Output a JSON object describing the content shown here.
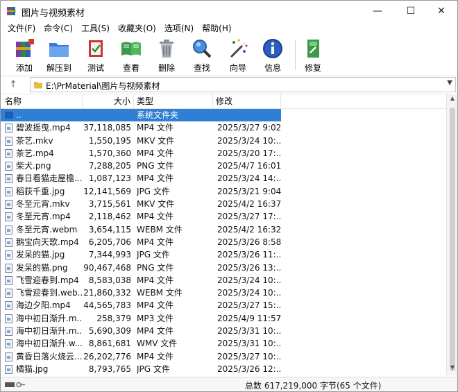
{
  "window": {
    "title": "图片与视频素材",
    "minimize_glyph": "—",
    "maximize_glyph": "☐",
    "close_glyph": "✕"
  },
  "menu": [
    "文件(F)",
    "命令(C)",
    "工具(S)",
    "收藏夹(O)",
    "选项(N)",
    "帮助(H)"
  ],
  "toolbar": [
    {
      "label": "添加",
      "icon": "add-archive-icon"
    },
    {
      "label": "解压到",
      "icon": "extract-folder-icon"
    },
    {
      "label": "测试",
      "icon": "test-icon"
    },
    {
      "label": "查看",
      "icon": "view-book-icon"
    },
    {
      "label": "删除",
      "icon": "trash-icon"
    },
    {
      "label": "查找",
      "icon": "find-magnifier-icon"
    },
    {
      "label": "向导",
      "icon": "wizard-wand-icon"
    },
    {
      "label": "信息",
      "icon": "info-icon"
    },
    {
      "label": "修复",
      "icon": "repair-icon"
    }
  ],
  "address": {
    "path": "E:\\PrMaterial\\图片与视频素材"
  },
  "columns": {
    "name": "名称",
    "size": "大小",
    "type": "类型",
    "modified": "修改"
  },
  "rows": [
    {
      "name": "..",
      "size": "",
      "type": "系统文件夹",
      "modified": "",
      "selected": true
    },
    {
      "name": "碧波摇曳.mp4",
      "size": "37,118,085",
      "type": "MP4 文件",
      "modified": "2025/3/27 9:02"
    },
    {
      "name": "茶艺.mkv",
      "size": "1,550,195",
      "type": "MKV 文件",
      "modified": "2025/3/24 10:..."
    },
    {
      "name": "茶艺.mp4",
      "size": "1,570,360",
      "type": "MP4 文件",
      "modified": "2025/3/20 17:..."
    },
    {
      "name": "柴犬.png",
      "size": "7,288,205",
      "type": "PNG 文件",
      "modified": "2025/4/7 16:01"
    },
    {
      "name": "春日看猫走屋檐...",
      "size": "1,087,123",
      "type": "MP4 文件",
      "modified": "2025/3/24 14:..."
    },
    {
      "name": "稻荻千重.jpg",
      "size": "12,141,569",
      "type": "JPG 文件",
      "modified": "2025/3/21 9:04"
    },
    {
      "name": "冬至元宵.mkv",
      "size": "3,715,561",
      "type": "MKV 文件",
      "modified": "2025/4/2 16:37"
    },
    {
      "name": "冬至元宵.mp4",
      "size": "2,118,462",
      "type": "MP4 文件",
      "modified": "2025/3/27 17:..."
    },
    {
      "name": "冬至元宵.webm",
      "size": "3,654,115",
      "type": "WEBM 文件",
      "modified": "2025/4/2 16:32"
    },
    {
      "name": "鹅宝向天歌.mp4",
      "size": "6,205,706",
      "type": "MP4 文件",
      "modified": "2025/3/26 8:58"
    },
    {
      "name": "发呆的猫.jpg",
      "size": "7,344,993",
      "type": "JPG 文件",
      "modified": "2025/3/26 11:..."
    },
    {
      "name": "发呆的猫.png",
      "size": "90,467,468",
      "type": "PNG 文件",
      "modified": "2025/3/26 13:..."
    },
    {
      "name": "飞雪迎春到.mp4",
      "size": "8,583,038",
      "type": "MP4 文件",
      "modified": "2025/3/24 10:..."
    },
    {
      "name": "飞雪迎春到.web...",
      "size": "21,860,332",
      "type": "WEBM 文件",
      "modified": "2025/3/24 10:..."
    },
    {
      "name": "海边夕阳.mp4",
      "size": "44,565,783",
      "type": "MP4 文件",
      "modified": "2025/3/27 15:..."
    },
    {
      "name": "海中初日渐升.m...",
      "size": "258,379",
      "type": "MP3 文件",
      "modified": "2025/4/9 11:57"
    },
    {
      "name": "海中初日渐升.m...",
      "size": "5,690,309",
      "type": "MP4 文件",
      "modified": "2025/3/31 10:..."
    },
    {
      "name": "海中初日渐升.w...",
      "size": "8,861,681",
      "type": "WMV 文件",
      "modified": "2025/3/31 10:..."
    },
    {
      "name": "黄昏日落火烧云...",
      "size": "26,202,776",
      "type": "MP4 文件",
      "modified": "2025/3/27 10:..."
    },
    {
      "name": "橘猫.jpg",
      "size": "8,793,765",
      "type": "JPG 文件",
      "modified": "2025/3/26 12:..."
    }
  ],
  "status": {
    "summary": "总数 617,219,000 字节(65 个文件)"
  },
  "colors": {
    "selection": "#2f7fd4",
    "window_bg": "#ffffff"
  }
}
